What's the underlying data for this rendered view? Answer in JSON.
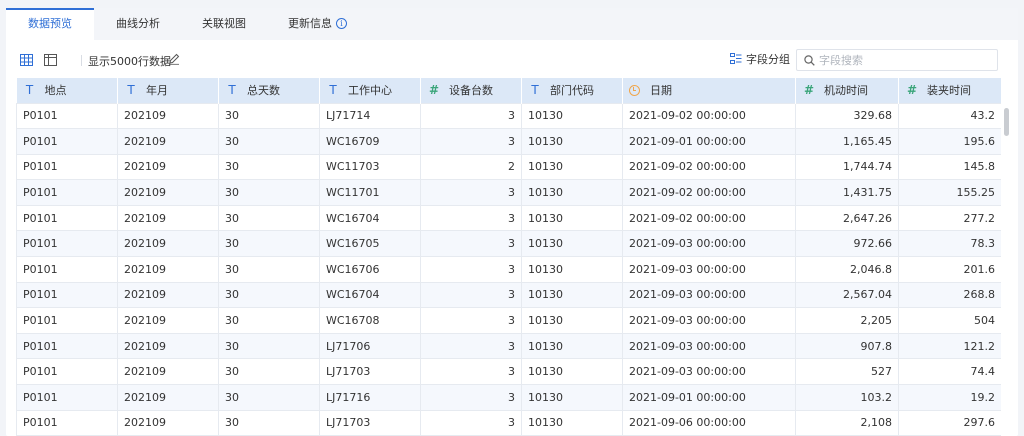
{
  "tabs": [
    {
      "label": "数据预览",
      "active": true
    },
    {
      "label": "曲线分析",
      "active": false
    },
    {
      "label": "关联视图",
      "active": false
    },
    {
      "label": "更新信息",
      "active": false,
      "icon": "info-icon"
    }
  ],
  "toolbar": {
    "grid_icon": "grid-view-icon",
    "panel_icon": "panel-view-icon",
    "rows_label": "显示5000行数据",
    "edit_icon": "edit-icon",
    "group_label": "字段分组",
    "search_placeholder": "字段搜索"
  },
  "colors": {
    "accent": "#2f6fd6",
    "header_bg": "#dce8f7",
    "num_type": "#3aa57a",
    "date_type": "#f0a54a"
  },
  "table": {
    "columns": [
      {
        "label": "地点",
        "type": "text"
      },
      {
        "label": "年月",
        "type": "text"
      },
      {
        "label": "总天数",
        "type": "text"
      },
      {
        "label": "工作中心",
        "type": "text"
      },
      {
        "label": "设备台数",
        "type": "number"
      },
      {
        "label": "部门代码",
        "type": "text"
      },
      {
        "label": "日期",
        "type": "date"
      },
      {
        "label": "机动时间",
        "type": "number"
      },
      {
        "label": "装夹时间",
        "type": "number"
      }
    ],
    "rows": [
      [
        "P0101",
        "202109",
        "30",
        "LJ71714",
        "3",
        "10130",
        "2021-09-02 00:00:00",
        "329.68",
        "43.2"
      ],
      [
        "P0101",
        "202109",
        "30",
        "WC16709",
        "3",
        "10130",
        "2021-09-01 00:00:00",
        "1,165.45",
        "195.6"
      ],
      [
        "P0101",
        "202109",
        "30",
        "WC11703",
        "2",
        "10130",
        "2021-09-02 00:00:00",
        "1,744.74",
        "145.8"
      ],
      [
        "P0101",
        "202109",
        "30",
        "WC11701",
        "3",
        "10130",
        "2021-09-02 00:00:00",
        "1,431.75",
        "155.25"
      ],
      [
        "P0101",
        "202109",
        "30",
        "WC16704",
        "3",
        "10130",
        "2021-09-02 00:00:00",
        "2,647.26",
        "277.2"
      ],
      [
        "P0101",
        "202109",
        "30",
        "WC16705",
        "3",
        "10130",
        "2021-09-03 00:00:00",
        "972.66",
        "78.3"
      ],
      [
        "P0101",
        "202109",
        "30",
        "WC16706",
        "3",
        "10130",
        "2021-09-03 00:00:00",
        "2,046.8",
        "201.6"
      ],
      [
        "P0101",
        "202109",
        "30",
        "WC16704",
        "3",
        "10130",
        "2021-09-03 00:00:00",
        "2,567.04",
        "268.8"
      ],
      [
        "P0101",
        "202109",
        "30",
        "WC16708",
        "3",
        "10130",
        "2021-09-03 00:00:00",
        "2,205",
        "504"
      ],
      [
        "P0101",
        "202109",
        "30",
        "LJ71706",
        "3",
        "10130",
        "2021-09-03 00:00:00",
        "907.8",
        "121.2"
      ],
      [
        "P0101",
        "202109",
        "30",
        "LJ71703",
        "3",
        "10130",
        "2021-09-03 00:00:00",
        "527",
        "74.4"
      ],
      [
        "P0101",
        "202109",
        "30",
        "LJ71716",
        "3",
        "10130",
        "2021-09-01 00:00:00",
        "103.2",
        "19.2"
      ],
      [
        "P0101",
        "202109",
        "30",
        "LJ71703",
        "3",
        "10130",
        "2021-09-06 00:00:00",
        "2,108",
        "297.6"
      ]
    ]
  }
}
